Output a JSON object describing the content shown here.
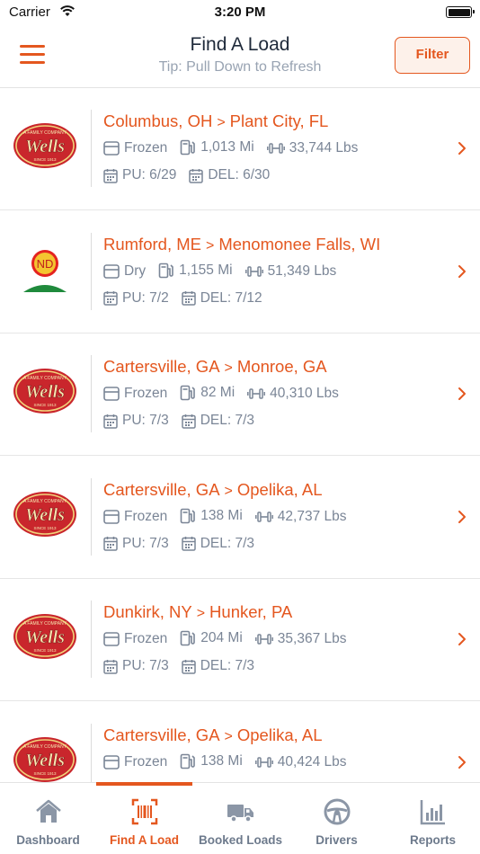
{
  "status_bar": {
    "carrier": "Carrier",
    "time": "3:20 PM"
  },
  "header": {
    "title": "Find A Load",
    "subtitle": "Tip: Pull Down to Refresh",
    "filter_label": "Filter"
  },
  "colors": {
    "accent": "#e4571f",
    "text_muted": "#7a8596",
    "tab_inactive": "#6d7a8c"
  },
  "loads": [
    {
      "logo": "wells-logo",
      "origin": "Columbus, OH",
      "destination": "Plant City, FL",
      "type": "Frozen",
      "distance": "1,013 Mi",
      "weight": "33,744 Lbs",
      "pickup": "PU: 6/29",
      "delivery": "DEL: 6/30"
    },
    {
      "logo": "nd-logo",
      "logo_text": "ND",
      "origin": "Rumford, ME",
      "destination": "Menomonee Falls, WI",
      "type": "Dry",
      "distance": "1,155 Mi",
      "weight": "51,349 Lbs",
      "pickup": "PU: 7/2",
      "delivery": "DEL: 7/12"
    },
    {
      "logo": "wells-logo",
      "origin": "Cartersville, GA",
      "destination": "Monroe, GA",
      "type": "Frozen",
      "distance": "82 Mi",
      "weight": "40,310 Lbs",
      "pickup": "PU: 7/3",
      "delivery": "DEL: 7/3"
    },
    {
      "logo": "wells-logo",
      "origin": "Cartersville, GA",
      "destination": "Opelika, AL",
      "type": "Frozen",
      "distance": "138 Mi",
      "weight": "42,737 Lbs",
      "pickup": "PU: 7/3",
      "delivery": "DEL: 7/3"
    },
    {
      "logo": "wells-logo",
      "origin": "Dunkirk, NY",
      "destination": "Hunker, PA",
      "type": "Frozen",
      "distance": "204 Mi",
      "weight": "35,367 Lbs",
      "pickup": "PU: 7/3",
      "delivery": "DEL: 7/3"
    },
    {
      "logo": "wells-logo",
      "origin": "Cartersville, GA",
      "destination": "Opelika, AL",
      "type": "Frozen",
      "distance": "138 Mi",
      "weight": "40,424 Lbs",
      "pickup": "",
      "delivery": ""
    }
  ],
  "wells_logo": {
    "top_text": "A FAMILY COMPANY",
    "name": "Wells",
    "bottom_text": "SINCE 1913"
  },
  "tabs": [
    {
      "label": "Dashboard",
      "icon": "home-icon",
      "active": false
    },
    {
      "label": "Find A Load",
      "icon": "barcode-icon",
      "active": true
    },
    {
      "label": "Booked Loads",
      "icon": "truck-icon",
      "active": false
    },
    {
      "label": "Drivers",
      "icon": "steering-wheel-icon",
      "active": false
    },
    {
      "label": "Reports",
      "icon": "bar-chart-icon",
      "active": false
    }
  ]
}
